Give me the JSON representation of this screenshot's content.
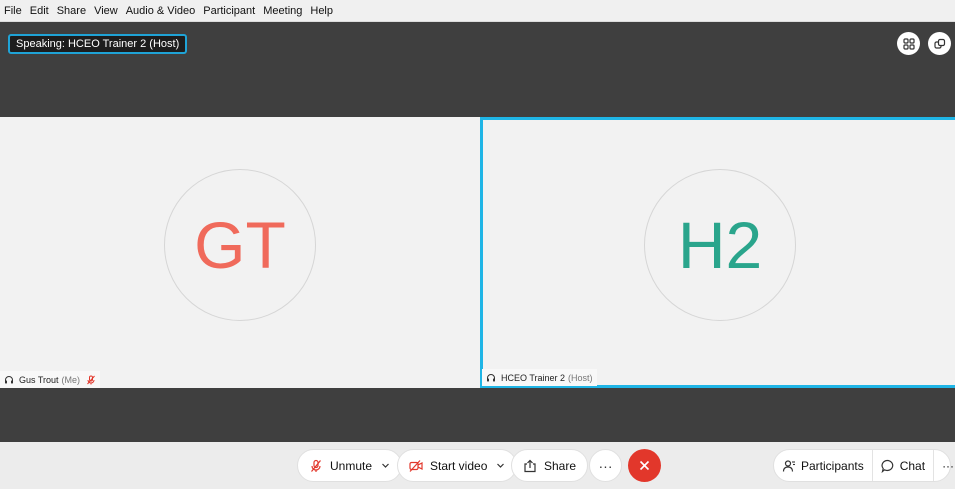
{
  "menubar": {
    "items": [
      "File",
      "Edit",
      "Share",
      "View",
      "Audio & Video",
      "Participant",
      "Meeting",
      "Help"
    ]
  },
  "stage": {
    "speaking_label": "Speaking: HCEO Trainer 2 (Host)",
    "grid_icon": "grid-layout-icon",
    "popout_icon": "popout-icon"
  },
  "participants": [
    {
      "initials": "GT",
      "name": "Gus Trout",
      "role": "(Me)",
      "initials_color": "#f06a5b",
      "muted": true
    },
    {
      "initials": "H2",
      "name": "HCEO Trainer 2",
      "role": "(Host)",
      "initials_color": "#2aa58c",
      "active_speaker": true
    }
  ],
  "controls": {
    "unmute": "Unmute",
    "start_video": "Start video",
    "share": "Share",
    "more": "···",
    "participants": "Participants",
    "chat": "Chat",
    "more_right": "···"
  },
  "colors": {
    "active_border": "#1fb5e6",
    "end_button": "#e2372b",
    "mute_red": "#e2372b"
  }
}
